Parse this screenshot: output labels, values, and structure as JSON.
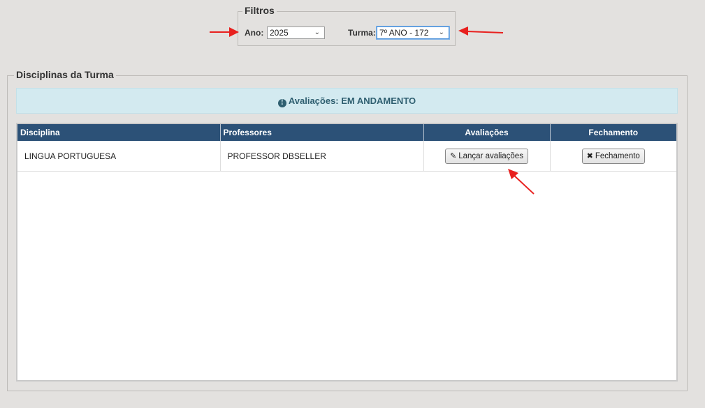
{
  "filtros": {
    "legend": "Filtros",
    "ano_label": "Ano:",
    "ano_value": "2025",
    "turma_label": "Turma:",
    "turma_value": "7º ANO - 172"
  },
  "disciplinas": {
    "legend": "Disciplinas da Turma",
    "alert_text": "Avaliações: EM ANDAMENTO",
    "columns": [
      "Disciplina",
      "Professores",
      "Avaliações",
      "Fechamento"
    ],
    "rows": [
      {
        "disciplina": "LINGUA PORTUGUESA",
        "professor": "PROFESSOR DBSELLER",
        "avaliacoes_button": "Lançar avaliações",
        "fechamento_button": "Fechamento"
      }
    ]
  },
  "colors": {
    "header_bg": "#2c5177",
    "alert_bg": "#d3eaf0",
    "alert_text": "#2f5f70",
    "annotation_arrow": "#e8201e"
  },
  "icons": {
    "alert": "info-circle-icon",
    "lancar": "pencil-icon",
    "fechamento": "tools-icon",
    "select": "chevron-down-icon"
  }
}
